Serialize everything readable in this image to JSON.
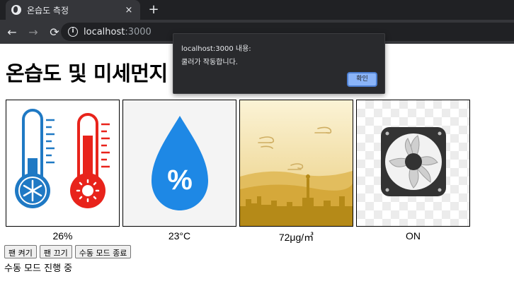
{
  "browser": {
    "tab_title": "온습도 측정",
    "tab_close": "×",
    "new_tab": "+",
    "url_host": "localhost",
    "url_port": ":3000",
    "back": "←",
    "forward": "→",
    "reload": "⟳",
    "info": "i"
  },
  "page": {
    "title": "온습도 및 미세먼지",
    "cards": [
      {
        "icon": "thermometer-icon",
        "value": "26%"
      },
      {
        "icon": "water-drop-percent-icon",
        "value": "23°C"
      },
      {
        "icon": "fine-dust-city-icon",
        "value": "72μg/㎥"
      },
      {
        "icon": "fan-icon",
        "value": "ON"
      }
    ],
    "drop_symbol": "%",
    "buttons": {
      "fan_on": "팬 켜기",
      "fan_off": "팬 끄기",
      "manual_end": "수동 모드 종료"
    },
    "status": "수동 모드 진행 중"
  },
  "dialog": {
    "title": "localhost:3000 내용:",
    "message": "쿨러가 작동합니다.",
    "ok": "확인"
  },
  "colors": {
    "cold_blue": "#1f79c4",
    "hot_red": "#e8231b",
    "drop_blue": "#1e88e5",
    "dust_gold": "#c79a22",
    "fan_dark": "#333333"
  }
}
